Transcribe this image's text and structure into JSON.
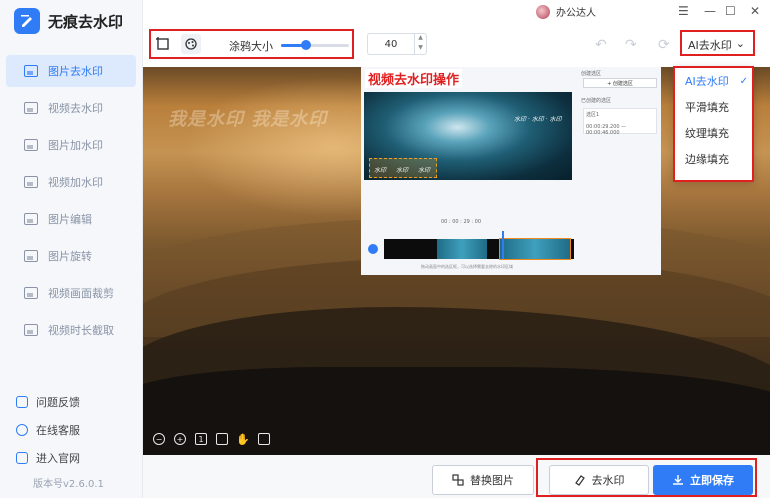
{
  "app": {
    "title": "无痕去水印"
  },
  "titlebar": {
    "user_name": "办公达人",
    "controls": [
      "☰",
      "—",
      "☐",
      "✕"
    ]
  },
  "sidebar": {
    "items": [
      {
        "label": "图片去水印",
        "active": true
      },
      {
        "label": "视频去水印",
        "active": false
      },
      {
        "label": "图片加水印",
        "active": false
      },
      {
        "label": "视频加水印",
        "active": false
      },
      {
        "label": "图片编辑",
        "active": false
      },
      {
        "label": "图片旋转",
        "active": false
      },
      {
        "label": "视频画面裁剪",
        "active": false
      },
      {
        "label": "视频时长截取",
        "active": false
      }
    ],
    "footer": [
      {
        "label": "问题反馈",
        "icon": "feedback-icon"
      },
      {
        "label": "在线客服",
        "icon": "service-icon"
      },
      {
        "label": "进入官网",
        "icon": "website-icon"
      }
    ],
    "version": "版本号v2.6.0.1"
  },
  "toolbar": {
    "brush_label": "涂鸦大小",
    "brush_level": 0.37,
    "brush_value": "40",
    "mode_selected": "AI去水印"
  },
  "dropdown": {
    "options": [
      {
        "label": "AI去水印",
        "selected": true
      },
      {
        "label": "平滑填充",
        "selected": false
      },
      {
        "label": "纹理填充",
        "selected": false
      },
      {
        "label": "边缘填充",
        "selected": false
      }
    ]
  },
  "canvas": {
    "watermark_text": "我是水印 我是水印",
    "inset": {
      "title": "视频去水印操作",
      "create_area_label": "创建选区",
      "create_button": "+ 创建选区",
      "created_label": "已创建的选区",
      "area_name": "选区1",
      "area_time": "00:00:29.200 — 00:00:46.000",
      "wm_labels": [
        "水印",
        "水印",
        "水印"
      ],
      "video_wm": "水印 · 水印 · 水印",
      "timecode": "00 : 00 : 29 : 00",
      "footer_hint": "拖动画面中的选区框，可以选择需要去除的水印区域"
    }
  },
  "bottombar": {
    "replace_label": "替换图片",
    "remove_label": "去水印",
    "save_label": "立即保存"
  },
  "colors": {
    "accent": "#2f7cf6",
    "highlight": "#e02020"
  }
}
